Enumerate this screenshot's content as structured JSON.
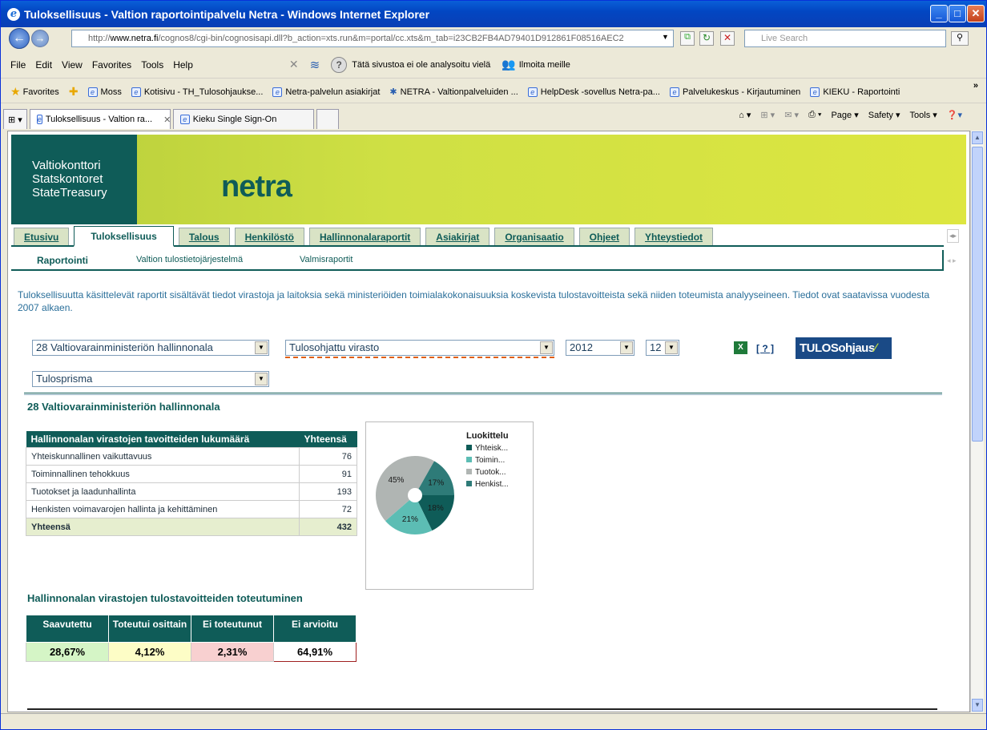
{
  "browser": {
    "title": "Tuloksellisuus - Valtion raportointipalvelu Netra - Windows Internet Explorer",
    "address_pre": "http://",
    "address_host": "www.netra.fi",
    "address_rest": "/cognos8/cgi-bin/cognosisapi.dll?b_action=xts.run&m=portal/cc.xts&m_tab=i23CB2FB4AD79401D912861F08516AEC2",
    "search_placeholder": "Live Search",
    "menu": [
      "File",
      "Edit",
      "View",
      "Favorites",
      "Tools",
      "Help"
    ],
    "phishing_text": "Tätä sivustoa ei ole analysoitu vielä",
    "report_text": "Ilmoita meille",
    "favorites_label": "Favorites",
    "favorites": [
      "Moss",
      "Kotisivu - TH_Tulosohjaukse...",
      "Netra-palvelun asiakirjat",
      "NETRA - Valtionpalveluiden ...",
      "HelpDesk -sovellus Netra-pa...",
      "Palvelukeskus - Kirjautuminen",
      "KIEKU - Raportointi"
    ],
    "tabs": [
      "Tuloksellisuus - Valtion ra...",
      "Kieku Single Sign-On"
    ],
    "commands": [
      "Page",
      "Safety",
      "Tools"
    ]
  },
  "banner": {
    "org_line1": "Valtiokonttori",
    "org_line2": "Statskontoret",
    "org_line3": "StateTreasury",
    "product": "netra"
  },
  "nav": {
    "tabs": [
      "Etusivu",
      "Tuloksellisuus",
      "Talous",
      "Henkilöstö",
      "Hallinnonalaraportit",
      "Asiakirjat",
      "Organisaatio",
      "Ohjeet",
      "Yhteystiedot"
    ],
    "active": "Tuloksellisuus",
    "subnav": [
      "Raportointi",
      "Valtion tulostietojärjestelmä",
      "Valmisraportit"
    ]
  },
  "intro": "Tuloksellisuutta käsittelevät raportit sisältävät tiedot virastoja ja laitoksia sekä ministeriöiden toimialakokonaisuuksia koskevista tulostavoitteista sekä niiden toteumista analyyseineen. Tiedot ovat saatavissa vuodesta 2007 alkaen.",
  "filters": {
    "hallinnonala": "28 Valtiovarainministeriön hallinnonala",
    "virasto": "Tulosohjattu virasto",
    "year": "2012",
    "month": "12",
    "view": "Tulosprisma",
    "help": "[ ? ]",
    "brand_logo": "TULOSohjaus"
  },
  "section_title": "28 Valtiovarainministeriön hallinnonala",
  "table1": {
    "headers": [
      "Hallinnonalan virastojen tavoitteiden lukumäärä",
      "Yhteensä"
    ],
    "rows": [
      [
        "Yhteiskunnallinen vaikuttavuus",
        "76"
      ],
      [
        "Toiminnallinen tehokkuus",
        "91"
      ],
      [
        "Tuotokset ja laadunhallinta",
        "193"
      ],
      [
        "Henkisten voimavarojen hallinta ja kehittäminen",
        "72"
      ]
    ],
    "total": [
      "Yhteensä",
      "432"
    ]
  },
  "chart_data": {
    "type": "pie",
    "title": "",
    "legend_title": "Luokittelu",
    "categories": [
      "Yhteisk...",
      "Toimin...",
      "Tuotok...",
      "Henkist..."
    ],
    "values": [
      18,
      21,
      45,
      17
    ],
    "labels": [
      "18%",
      "21%",
      "45%",
      "17%"
    ],
    "colors": [
      "#0f5c58",
      "#5cbdb4",
      "#b0b5b3",
      "#2e7b78"
    ],
    "legend_position": "top-right",
    "donut": true
  },
  "section2_title": "Hallinnonalan virastojen tulostavoitteiden toteutuminen",
  "table2": {
    "headers": [
      "Saavutettu",
      "Toteutui osittain",
      "Ei toteutunut",
      "Ei arvioitu"
    ],
    "values": [
      "28,67%",
      "4,12%",
      "2,31%",
      "64,91%"
    ],
    "colors": [
      "#d5f5c6",
      "#fdfdc6",
      "#f8d0d0",
      "#ffffff"
    ]
  }
}
